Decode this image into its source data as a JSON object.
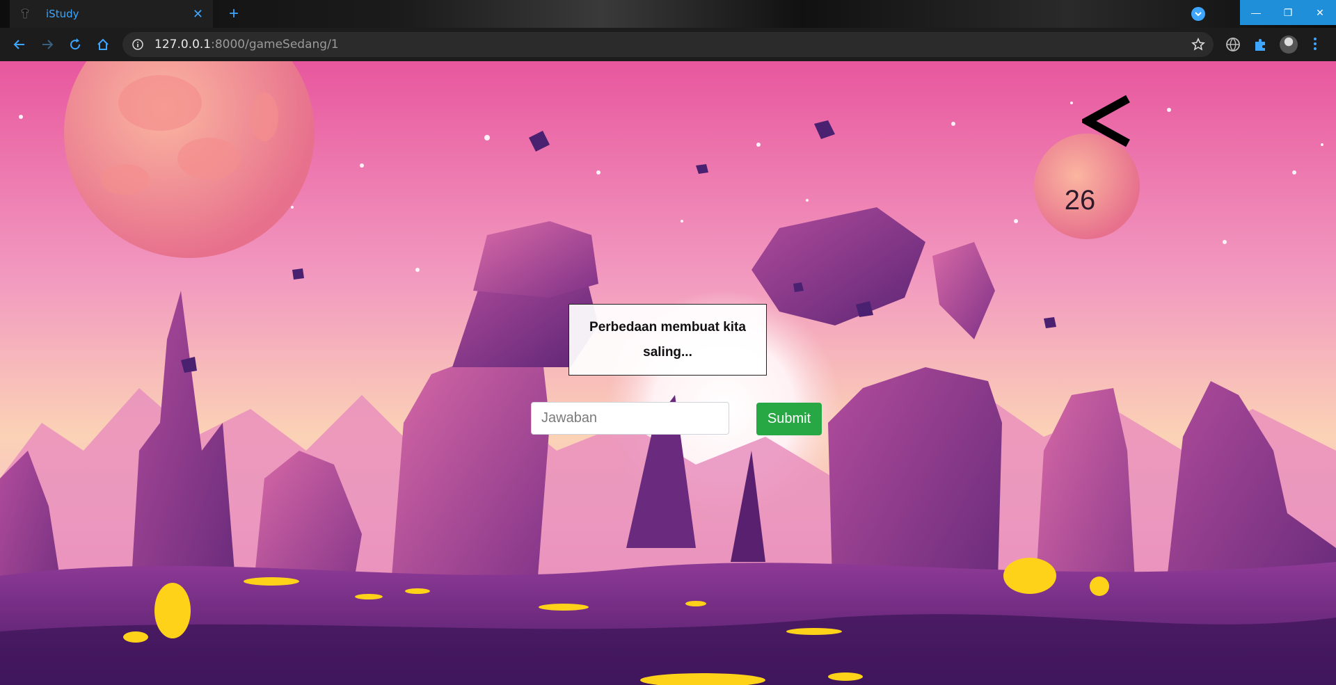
{
  "browser": {
    "tab_title": "iStudy",
    "tab_close": "✕",
    "new_tab": "+",
    "url_host": "127.0.0.1",
    "url_path": ":8000/gameSedang/1",
    "window_buttons": {
      "minimize": "—",
      "restore": "❐",
      "close": "✕"
    }
  },
  "game": {
    "question": "Perbedaan membuat kita saling...",
    "answer_placeholder": "Jawaban",
    "answer_value": "",
    "submit_label": "Submit",
    "timer": "26",
    "back_label": "<"
  },
  "colors": {
    "accent": "#3ea6ff",
    "submit_green": "#28a745",
    "window_button_blue": "#1e8fd8"
  }
}
